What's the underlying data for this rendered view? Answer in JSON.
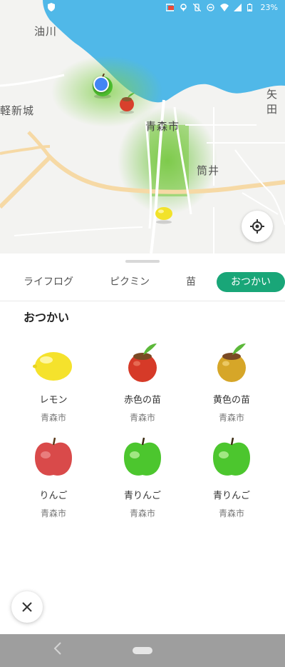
{
  "status_bar": {
    "battery": "23%"
  },
  "map": {
    "labels": [
      {
        "id": "aburakawa",
        "text": "油川"
      },
      {
        "id": "tsugaru-shinjo",
        "text": "軽新城"
      },
      {
        "id": "aomori-shi",
        "text": "青森市"
      },
      {
        "id": "tsutsui",
        "text": "筒井"
      },
      {
        "id": "yata",
        "text": "矢田"
      }
    ]
  },
  "tabs": [
    {
      "label": "ライフログ",
      "active": false
    },
    {
      "label": "ピクミン",
      "active": false
    },
    {
      "label": "苗",
      "active": false
    },
    {
      "label": "おつかい",
      "active": true
    }
  ],
  "section_title": "おつかい",
  "items": [
    {
      "name": "レモン",
      "place": "青森市",
      "icon": "lemon-icon"
    },
    {
      "name": "赤色の苗",
      "place": "青森市",
      "icon": "red-seedling-icon"
    },
    {
      "name": "黄色の苗",
      "place": "青森市",
      "icon": "yellow-seedling-icon"
    },
    {
      "name": "りんご",
      "place": "青森市",
      "icon": "red-apple-icon"
    },
    {
      "name": "青りんご",
      "place": "青森市",
      "icon": "green-apple-icon"
    },
    {
      "name": "青りんご",
      "place": "青森市",
      "icon": "green-apple-icon"
    }
  ],
  "colors": {
    "accent": "#19a678",
    "sea": "#50b8e8",
    "green_area": "#8fd14f"
  }
}
